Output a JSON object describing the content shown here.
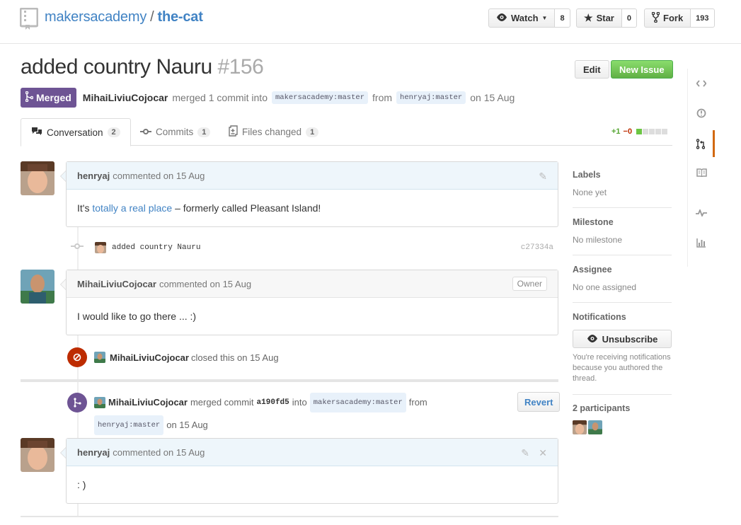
{
  "header": {
    "owner": "makersacademy",
    "separator": "/",
    "repo": "the-cat",
    "watch_label": "Watch",
    "watch_count": "8",
    "star_label": "Star",
    "star_count": "0",
    "fork_label": "Fork",
    "fork_count": "193"
  },
  "pr": {
    "title": "added country Nauru",
    "number": "#156",
    "edit_label": "Edit",
    "new_issue_label": "New Issue",
    "state": "Merged",
    "author": "MihaiLiviuCojocar",
    "merged_text": "merged 1 commit into",
    "base_ref": "makersacademy:master",
    "from_text": "from",
    "head_ref": "henryaj:master",
    "date_text": "on 15 Aug"
  },
  "tabs": [
    {
      "label": "Conversation",
      "count": "2"
    },
    {
      "label": "Commits",
      "count": "1"
    },
    {
      "label": "Files changed",
      "count": "1"
    }
  ],
  "diffstat": {
    "additions": "+1",
    "deletions": "−0"
  },
  "timeline": {
    "comment1": {
      "author": "henryaj",
      "meta": "commented on 15 Aug",
      "body_prefix": "It's ",
      "body_link": "totally a real place",
      "body_suffix": " – formerly called Pleasant Island!"
    },
    "commit": {
      "message": "added country Nauru",
      "sha": "c27334a"
    },
    "comment2": {
      "author": "MihaiLiviuCojocar",
      "meta": "commented on 15 Aug",
      "badge": "Owner",
      "body": "I would like to go there ... :)"
    },
    "closed_event": {
      "actor": "MihaiLiviuCojocar",
      "text": "closed this on 15 Aug"
    },
    "merged_event": {
      "actor": "MihaiLiviuCojocar",
      "text": "merged commit",
      "sha": "a190fd5",
      "into": "into",
      "base_ref": "makersacademy:master",
      "from": "from",
      "head_ref": "henryaj:master",
      "date": "on 15 Aug",
      "revert_label": "Revert"
    },
    "comment3": {
      "author": "henryaj",
      "meta": "commented on 15 Aug",
      "body": ": )"
    }
  },
  "sidebar": {
    "labels_head": "Labels",
    "labels_val": "None yet",
    "milestone_head": "Milestone",
    "milestone_val": "No milestone",
    "assignee_head": "Assignee",
    "assignee_val": "No one assigned",
    "notifications_head": "Notifications",
    "unsubscribe_label": "Unsubscribe",
    "notifications_note": "You're receiving notifications because you authored the thread.",
    "participants_head": "2 participants"
  },
  "colors": {
    "link": "#4183c4",
    "merged": "#6e5494",
    "closed": "#bd2c00",
    "new_issue": "#60b044",
    "nav_active": "#d26911"
  }
}
